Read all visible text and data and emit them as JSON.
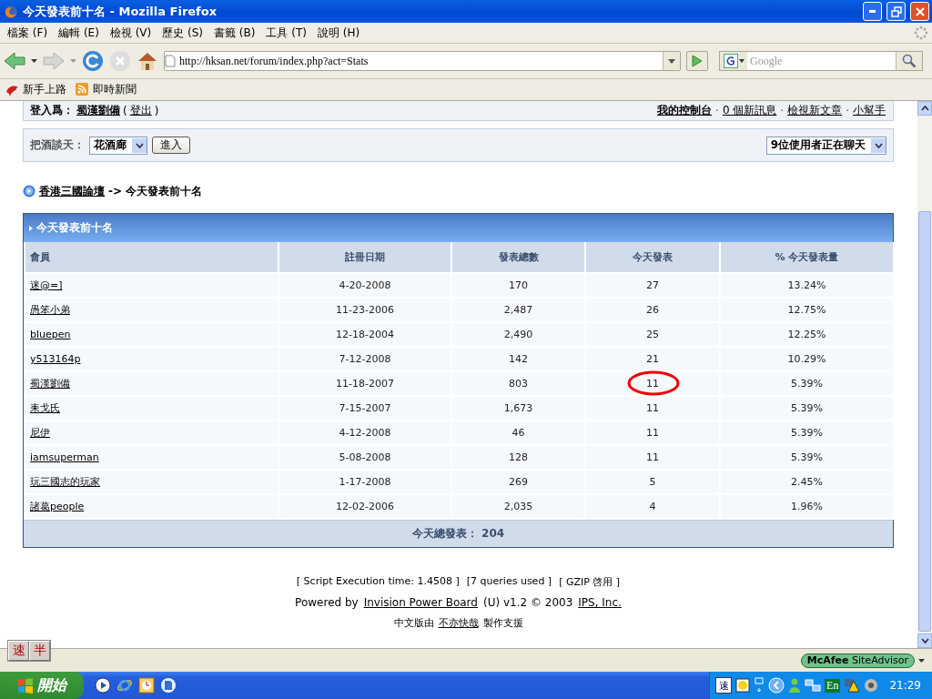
{
  "window": {
    "title": "今天發表前十名 - Mozilla Firefox"
  },
  "menu": [
    "檔案 (F)",
    "編輯 (E)",
    "檢視 (V)",
    "歷史 (S)",
    "書籤 (B)",
    "工具 (T)",
    "說明 (H)"
  ],
  "toolbar": {
    "url": "http://hksan.net/forum/index.php?act=Stats",
    "search_placeholder": "Google"
  },
  "bookmarks": [
    "新手上路",
    "即時新聞"
  ],
  "userbar": {
    "prefix": "登入爲：",
    "user": "蜀漢劉備",
    "paren_open": "(",
    "logout": "登出",
    "paren_close": ")",
    "separator": "·",
    "links": [
      "我的控制台",
      "0 個新訊息",
      "檢視新文章",
      "小幫手"
    ]
  },
  "chatbar": {
    "label": "把酒談天：",
    "room": "花酒廊",
    "button": "進入",
    "users": "9位使用者正在聊天"
  },
  "breadcrumb": {
    "home": "香港三國論壇",
    "separator": "->",
    "current": "今天發表前十名"
  },
  "table": {
    "title": "今天發表前十名",
    "columns": [
      "會員",
      "註冊日期",
      "發表總數",
      "今天發表",
      "% 今天發表量"
    ],
    "rows": [
      {
        "cells": [
          "迷@=]",
          "4-20-2008",
          "170",
          "27",
          "13.24%"
        ],
        "circled": false
      },
      {
        "cells": [
          "愚笨小弟",
          "11-23-2006",
          "2,487",
          "26",
          "12.75%"
        ],
        "circled": false
      },
      {
        "cells": [
          "bluepen",
          "12-18-2004",
          "2,490",
          "25",
          "12.25%"
        ],
        "circled": false
      },
      {
        "cells": [
          "y513164p",
          "7-12-2008",
          "142",
          "21",
          "10.29%"
        ],
        "circled": false
      },
      {
        "cells": [
          "蜀漢劉備",
          "11-18-2007",
          "803",
          "11",
          "5.39%"
        ],
        "circled": true
      },
      {
        "cells": [
          "耒戈氏",
          "7-15-2007",
          "1,673",
          "11",
          "5.39%"
        ],
        "circled": false
      },
      {
        "cells": [
          "尼伊",
          "4-12-2008",
          "46",
          "11",
          "5.39%"
        ],
        "circled": false
      },
      {
        "cells": [
          "iamsuperman",
          "5-08-2008",
          "128",
          "11",
          "5.39%"
        ],
        "circled": false
      },
      {
        "cells": [
          "玩三國志的玩家",
          "1-17-2008",
          "269",
          "5",
          "2.45%"
        ],
        "circled": false
      },
      {
        "cells": [
          "諸葛people",
          "12-02-2006",
          "2,035",
          "4",
          "1.96%"
        ],
        "circled": false
      }
    ],
    "footer": "今天總發表： 204"
  },
  "page_footer": {
    "stats": [
      "[ Script Execution time: 1.4508 ]",
      "[7 queries used ]",
      "[ GZIP 啓用 ]"
    ],
    "powered": {
      "text": "Powered by",
      "link": "Invision Power Board",
      "after": "(U) v1.2 © 2003",
      "company": "IPS, Inc."
    },
    "credit": {
      "before": "中文版由",
      "link": "不亦快哉",
      "after": "製作支援"
    }
  },
  "statusbar": {
    "ime_keys": [
      "速",
      "半"
    ],
    "siteadvisor": "**McAfee** SiteAdvisor"
  },
  "taskbar": {
    "start": "開始",
    "tray_ime": "速",
    "language": "En",
    "clock": "21:29"
  }
}
